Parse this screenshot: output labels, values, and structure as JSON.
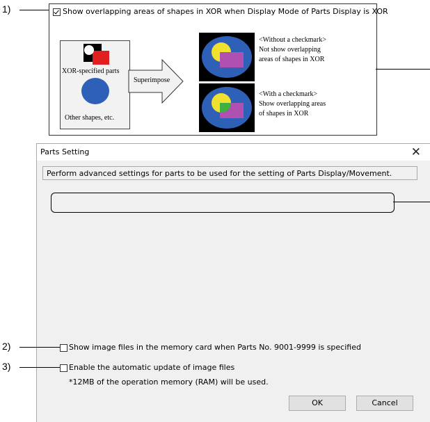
{
  "callouts": {
    "one": "1)",
    "two": "2)",
    "three": "3)"
  },
  "explanation": {
    "checkbox_label": "Show overlapping areas of shapes in XOR when Display Mode of Parts Display is XOR",
    "source_labels": {
      "xor_parts": "XOR-specified parts",
      "other_shapes": "Other shapes, etc."
    },
    "arrow_label": "Superimpose",
    "without_title": "<Without a checkmark>",
    "without_line1": "Not show overlapping",
    "without_line2": "areas of shapes in XOR",
    "with_title": "<With a checkmark>",
    "with_line1": "Show overlapping areas",
    "with_line2": "of shapes in XOR",
    "colors": {
      "blue": "#2e60b8",
      "red": "#e02020",
      "yellow": "#f0e030",
      "purple": "#b050b0",
      "green": "#40b040"
    }
  },
  "dialog": {
    "title": "Parts Setting",
    "close_icon": "close-icon",
    "description": "Perform advanced settings for parts to be used for the setting of Parts Display/Movement.",
    "option_image_files": "Show image files in the memory card when Parts No. 9001-9999 is specified",
    "option_auto_update": "Enable the automatic update of image files",
    "memory_note": "*12MB of the operation memory (RAM) will be used.",
    "ok_label": "OK",
    "cancel_label": "Cancel"
  }
}
